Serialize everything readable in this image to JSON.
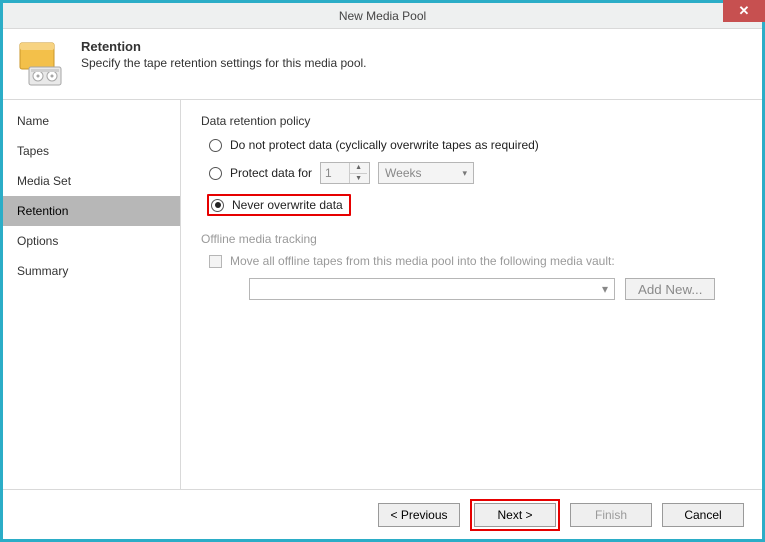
{
  "window": {
    "title": "New Media Pool"
  },
  "header": {
    "title": "Retention",
    "subtitle": "Specify the tape retention settings for this media pool."
  },
  "sidebar": {
    "items": [
      {
        "label": "Name"
      },
      {
        "label": "Tapes"
      },
      {
        "label": "Media Set"
      },
      {
        "label": "Retention"
      },
      {
        "label": "Options"
      },
      {
        "label": "Summary"
      }
    ],
    "selected_index": 3
  },
  "content": {
    "section_title": "Data retention policy",
    "radios": {
      "do_not_protect": "Do not protect data (cyclically overwrite tapes as required)",
      "protect_for": "Protect data for",
      "never_overwrite": "Never overwrite data"
    },
    "protect_value": "1",
    "protect_unit": "Weeks",
    "offline_title": "Offline media tracking",
    "offline_checkbox_label": "Move all offline tapes from this media pool into the following media vault:",
    "add_new_label": "Add New..."
  },
  "footer": {
    "previous": "< Previous",
    "next": "Next >",
    "finish": "Finish",
    "cancel": "Cancel"
  }
}
